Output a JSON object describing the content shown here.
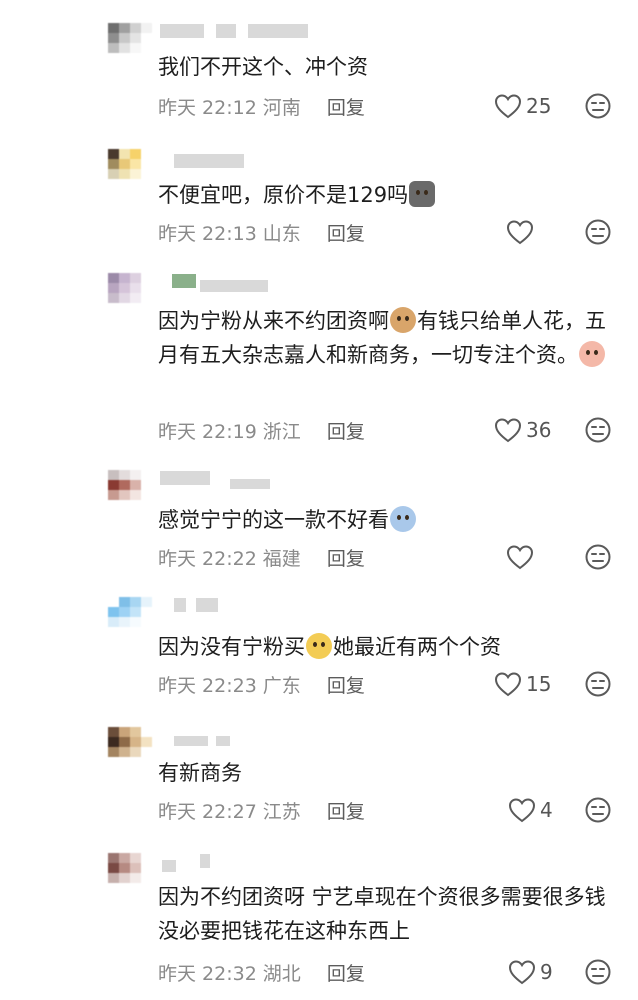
{
  "comments": [
    {
      "text_parts": [
        "我们不开这个、冲个资"
      ],
      "time": "昨天 22:12",
      "region": "河南",
      "reply": "回复",
      "likes": "25",
      "avatar_colors": [
        "#6e6e6e",
        "#a0a0a0",
        "#d0d0d0",
        "#f2f2f2",
        "#8e8e8e",
        "#c8c8c8",
        "#e4e4e4",
        "#ffffff",
        "#bdbdbd",
        "#e2e2e2",
        "#f7f7f7",
        "#ffffff"
      ]
    },
    {
      "text_parts": [
        "不便宜吧，原价不是129吗"
      ],
      "emoji_after": [
        "cat-emoji"
      ],
      "time": "昨天 22:13",
      "region": "山东",
      "reply": "回复",
      "likes": "",
      "avatar_colors": [
        "#4a3a2e",
        "#f3e4b0",
        "#f6d26a",
        "#ffffff",
        "#a08c5e",
        "#e8c878",
        "#fae6a6",
        "#ffffff",
        "#d8d0b4",
        "#efe2b2",
        "#fbf3d6",
        "#ffffff"
      ]
    },
    {
      "text_parts": [
        "因为宁粉从来不约团资啊",
        "有钱只给单人花，五月有五大杂志嘉人和新商务，一切专注个资。"
      ],
      "emoji_after": [
        "dog-emoji",
        "peach-emoji"
      ],
      "time": "昨天 22:19",
      "region": "浙江",
      "reply": "回复",
      "likes": "36",
      "avatar_colors": [
        "#9b8aa8",
        "#c6b4cf",
        "#ddd0e0",
        "#ffffff",
        "#b8a5c0",
        "#d5c4d9",
        "#e9dfeb",
        "#ffffff",
        "#c8bccb",
        "#e2d8e4",
        "#f2ecf3",
        "#ffffff"
      ]
    },
    {
      "text_parts": [
        "感觉宁宁的这一款不好看"
      ],
      "emoji_after": [
        "crying-emoji"
      ],
      "time": "昨天 22:22",
      "region": "福建",
      "reply": "回复",
      "likes": "",
      "avatar_colors": [
        "#c8bfbf",
        "#e3dcdc",
        "#f4f0f0",
        "#ffffff",
        "#8a3a32",
        "#b06a5e",
        "#d9b2aa",
        "#ffffff",
        "#c79a90",
        "#e2c6bf",
        "#f3e5e1",
        "#ffffff"
      ]
    },
    {
      "text_parts": [
        "因为没有宁粉买",
        "她最近有两个个资"
      ],
      "emoji_after": [
        "dizzy-emoji"
      ],
      "time": "昨天 22:23",
      "region": "广东",
      "reply": "回复",
      "likes": "15",
      "avatar_colors": [
        "#ffffff",
        "#7fbfe8",
        "#a8d6f2",
        "#e6f3fb",
        "#7ec3ee",
        "#9ed2f4",
        "#c3e4f8",
        "#ffffff",
        "#d8ecf9",
        "#e9f4fb",
        "#f6fbfe",
        "#ffffff"
      ]
    },
    {
      "text_parts": [
        "有新商务"
      ],
      "time": "昨天 22:27",
      "region": "江苏",
      "reply": "回复",
      "likes": "4",
      "avatar_colors": [
        "#6b4e3a",
        "#c9a47a",
        "#e2c79e",
        "#ffffff",
        "#3c2a20",
        "#8e6a48",
        "#d6b488",
        "#f3e2c2",
        "#a38460",
        "#cfb28e",
        "#ead8bc",
        "#ffffff"
      ]
    },
    {
      "text_parts": [
        "因为不约团资呀 宁艺卓现在个资很多需要很多钱 没必要把钱花在这种东西上"
      ],
      "time": "昨天 22:32",
      "region": "湖北",
      "reply": "回复",
      "likes": "9",
      "avatar_colors": [
        "#9a7570",
        "#c9a8a2",
        "#e8d6d2",
        "#ffffff",
        "#7a4a44",
        "#b68a82",
        "#dcc0ba",
        "#ffffff",
        "#c6b0ac",
        "#e2d2cf",
        "#f3ebe9",
        "#ffffff"
      ]
    }
  ],
  "colors": {
    "meta_gray": "#8a8a8a",
    "text": "#1e1e1e",
    "icon_gray": "#5a5a5a"
  },
  "icons": {
    "like": "heart-outline-icon",
    "dislike": "neutral-face-icon"
  }
}
